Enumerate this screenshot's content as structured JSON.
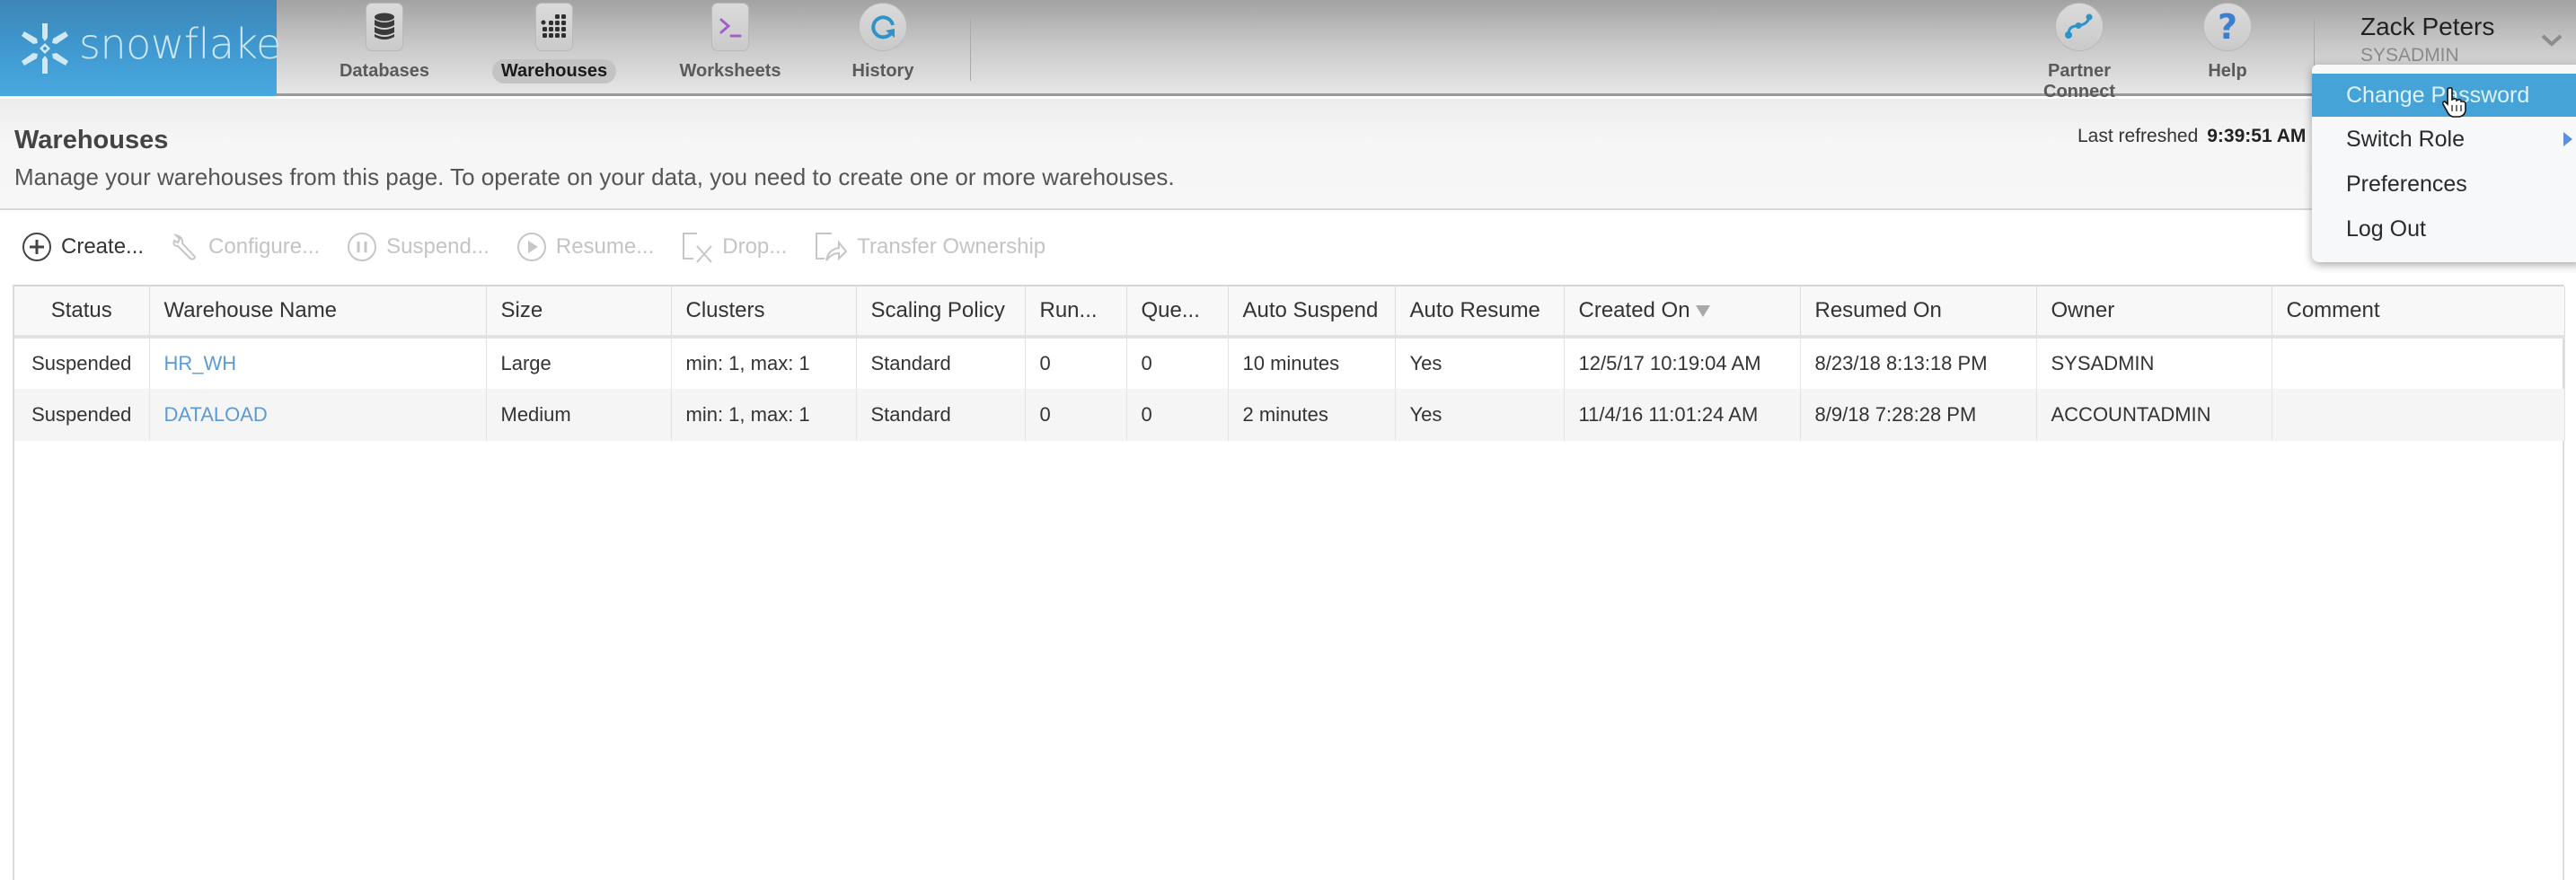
{
  "brand": {
    "name": "snowflake"
  },
  "nav": {
    "items": [
      {
        "label": "Databases",
        "icon": "database-icon",
        "active": false
      },
      {
        "label": "Warehouses",
        "icon": "warehouse-grid-icon",
        "active": true
      },
      {
        "label": "Worksheets",
        "icon": "terminal-prompt-icon",
        "active": false
      },
      {
        "label": "History",
        "icon": "history-refresh-icon",
        "active": false
      }
    ],
    "right_items": [
      {
        "label": "Partner Connect",
        "icon": "partner-connect-icon"
      },
      {
        "label": "Help",
        "icon": "question-mark-icon"
      }
    ]
  },
  "user": {
    "name": "Zack Peters",
    "role": "SYSADMIN"
  },
  "user_menu": {
    "items": [
      {
        "label": "Change Password",
        "highlighted": true,
        "submenu": false
      },
      {
        "label": "Switch Role",
        "highlighted": false,
        "submenu": true
      },
      {
        "label": "Preferences",
        "highlighted": false,
        "submenu": false
      },
      {
        "label": "Log Out",
        "highlighted": false,
        "submenu": false
      }
    ]
  },
  "page": {
    "title": "Warehouses",
    "description": "Manage your warehouses from this page. To operate on your data, you need to create one or more warehouses.",
    "last_refreshed_label": "Last refreshed",
    "last_refreshed_time": "9:39:51 AM"
  },
  "toolbar": {
    "create": "Create...",
    "configure": "Configure...",
    "suspend": "Suspend...",
    "resume": "Resume...",
    "drop": "Drop...",
    "transfer": "Transfer Ownership"
  },
  "table": {
    "columns": [
      "Status",
      "Warehouse Name",
      "Size",
      "Clusters",
      "Scaling Policy",
      "Run...",
      "Que...",
      "Auto Suspend",
      "Auto Resume",
      "Created On",
      "Resumed On",
      "Owner",
      "Comment"
    ],
    "sorted_column": "Created On",
    "sort_direction": "descending",
    "rows": [
      {
        "status": "Suspended",
        "name": "HR_WH",
        "size": "Large",
        "clusters": "min: 1, max: 1",
        "scaling_policy": "Standard",
        "running": "0",
        "queued": "0",
        "auto_suspend": "10 minutes",
        "auto_resume": "Yes",
        "created_on": "12/5/17 10:19:04 AM",
        "resumed_on": "8/23/18 8:13:18 PM",
        "owner": "SYSADMIN",
        "comment": ""
      },
      {
        "status": "Suspended",
        "name": "DATALOAD",
        "size": "Medium",
        "clusters": "min: 1, max: 1",
        "scaling_policy": "Standard",
        "running": "0",
        "queued": "0",
        "auto_suspend": "2 minutes",
        "auto_resume": "Yes",
        "created_on": "11/4/16 11:01:24 AM",
        "resumed_on": "8/9/18 7:28:28 PM",
        "owner": "ACCOUNTADMIN",
        "comment": ""
      }
    ]
  },
  "colors": {
    "brand_blue": "#3f98cf",
    "link_blue": "#5b9bd5",
    "menu_highlight": "#45a3d8",
    "worksheet_purple": "#a45fc8",
    "history_teal": "#2e93c6"
  }
}
